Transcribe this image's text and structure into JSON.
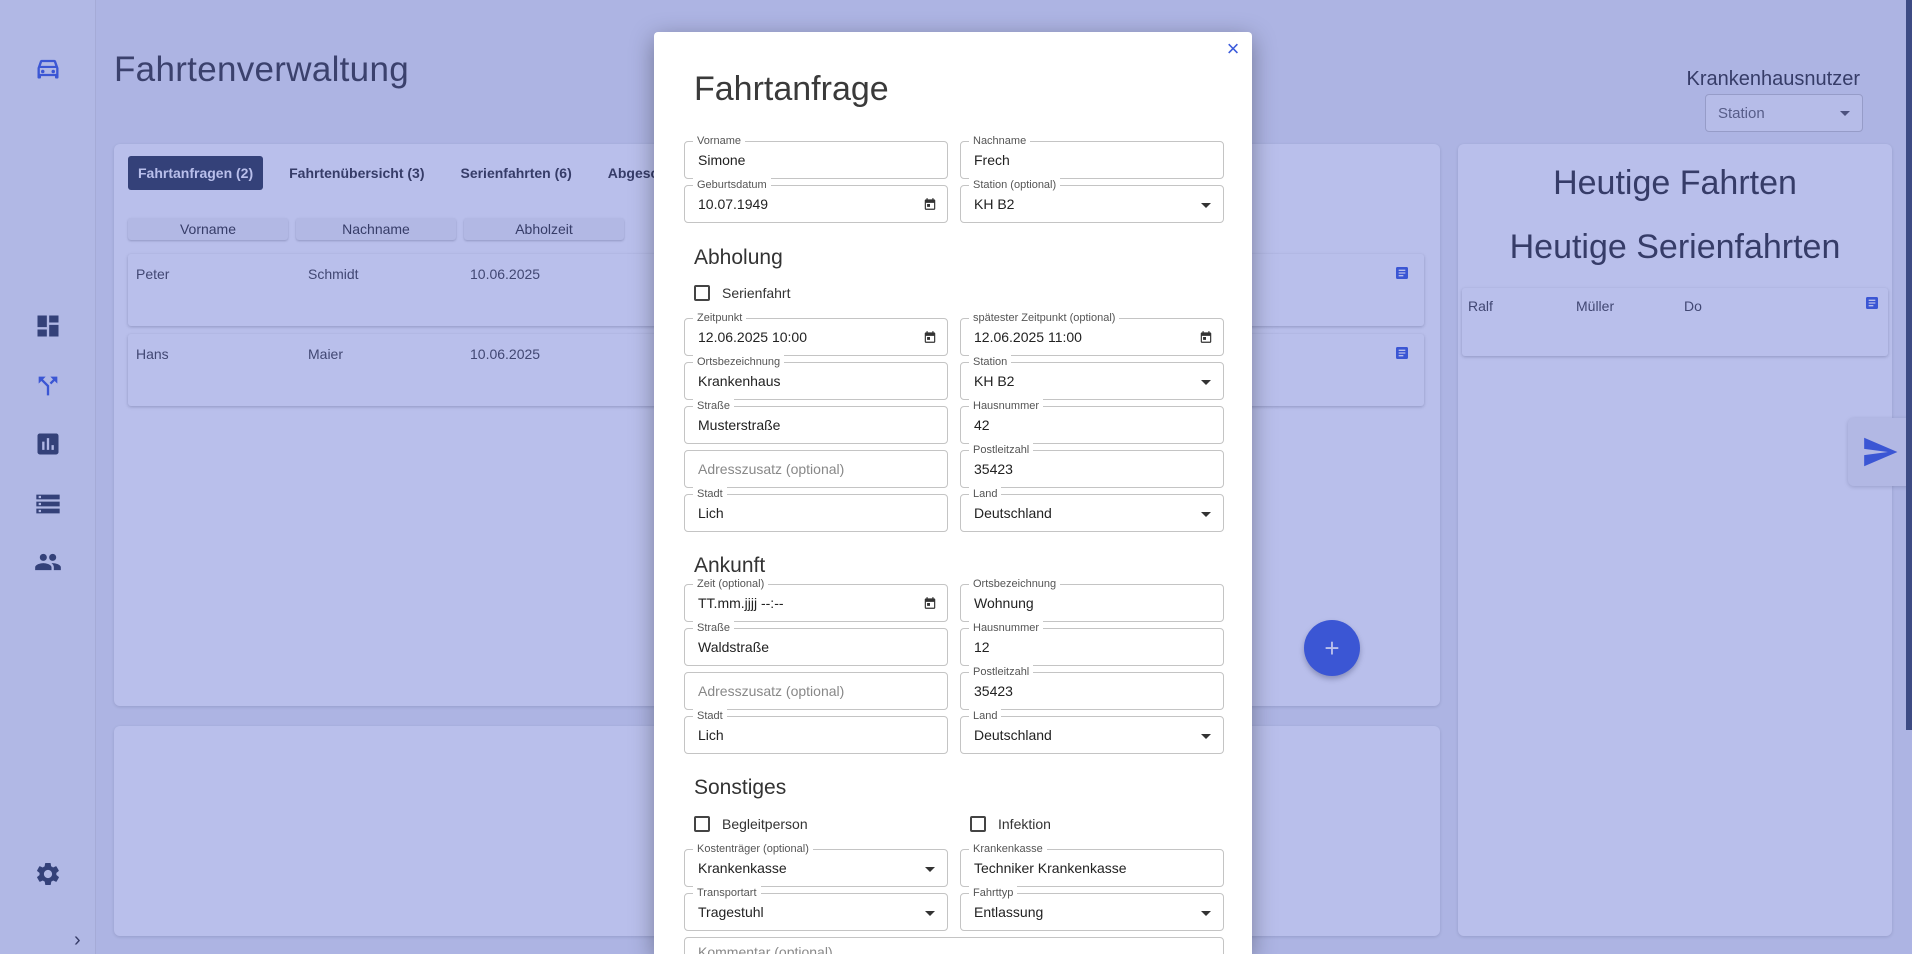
{
  "app": {
    "page_title": "Fahrtenverwaltung",
    "user_label": "Krankenhausnutzer",
    "station_select": "Station"
  },
  "tabs": [
    {
      "label": "Fahrtanfragen (2)",
      "active": true
    },
    {
      "label": "Fahrtenübersicht (3)",
      "active": false
    },
    {
      "label": "Serienfahrten (6)",
      "active": false
    },
    {
      "label": "Abgesc",
      "active": false
    }
  ],
  "table": {
    "headers": [
      "Vorname",
      "Nachname",
      "Abholzeit"
    ],
    "rows": [
      {
        "vorname": "Peter",
        "nachname": "Schmidt",
        "abholzeit": "10.06.2025"
      },
      {
        "vorname": "Hans",
        "nachname": "Maier",
        "abholzeit": "10.06.2025"
      }
    ]
  },
  "fab_label": "+",
  "right_panel": {
    "title1": "Heutige Fahrten",
    "title2": "Heutige Serienfahrten",
    "row": {
      "c1": "Ralf",
      "c2": "Müller",
      "c3": "Do"
    }
  },
  "modal": {
    "title": "Fahrtanfrage",
    "close": "×",
    "patient": {
      "vorname": {
        "label": "Vorname",
        "value": "Simone"
      },
      "nachname": {
        "label": "Nachname",
        "value": "Frech"
      },
      "geburtsdatum": {
        "label": "Geburtsdatum",
        "value": "10.07.1949"
      },
      "station": {
        "label": "Station (optional)",
        "value": "KH B2"
      }
    },
    "abholung": {
      "title": "Abholung",
      "serienfahrt": "Serienfahrt",
      "zeitpunkt": {
        "label": "Zeitpunkt",
        "value": "12.06.2025 10:00"
      },
      "spaetester": {
        "label": "spätester Zeitpunkt (optional)",
        "value": "12.06.2025 11:00"
      },
      "ortsbezeichnung": {
        "label": "Ortsbezeichnung",
        "value": "Krankenhaus"
      },
      "station": {
        "label": "Station",
        "value": "KH B2"
      },
      "strasse": {
        "label": "Straße",
        "value": "Musterstraße"
      },
      "hausnummer": {
        "label": "Hausnummer",
        "value": "42"
      },
      "adresszusatz": {
        "placeholder": "Adresszusatz (optional)"
      },
      "postleitzahl": {
        "label": "Postleitzahl",
        "value": "35423"
      },
      "stadt": {
        "label": "Stadt",
        "value": "Lich"
      },
      "land": {
        "label": "Land",
        "value": "Deutschland"
      }
    },
    "ankunft": {
      "title": "Ankunft",
      "zeit": {
        "label": "Zeit (optional)",
        "value": "TT.mm.jjjj --:--"
      },
      "ortsbezeichnung": {
        "label": "Ortsbezeichnung",
        "value": "Wohnung"
      },
      "strasse": {
        "label": "Straße",
        "value": "Waldstraße"
      },
      "hausnummer": {
        "label": "Hausnummer",
        "value": "12"
      },
      "adresszusatz": {
        "placeholder": "Adresszusatz (optional)"
      },
      "postleitzahl": {
        "label": "Postleitzahl",
        "value": "35423"
      },
      "stadt": {
        "label": "Stadt",
        "value": "Lich"
      },
      "land": {
        "label": "Land",
        "value": "Deutschland"
      }
    },
    "sonstiges": {
      "title": "Sonstiges",
      "begleitperson": "Begleitperson",
      "infektion": "Infektion",
      "kostentraeger": {
        "label": "Kostenträger (optional)",
        "value": "Krankenkasse"
      },
      "krankenkasse": {
        "label": "Krankenkasse",
        "value": "Techniker Krankenkasse"
      },
      "transportart": {
        "label": "Transportart",
        "value": "Tragestuhl"
      },
      "fahrttyp": {
        "label": "Fahrttyp",
        "value": "Entlassung"
      },
      "kommentar": {
        "placeholder": "Kommentar (optional)"
      }
    }
  },
  "colors": {
    "accent": "#3b5bdb",
    "overlay": "#3c4ec8",
    "tab_active": "#2f3b4d"
  },
  "icons": [
    "car-icon",
    "dashboard-icon",
    "route-icon",
    "chart-icon",
    "list-icon",
    "users-icon",
    "gear-icon",
    "calendar-icon",
    "document-icon",
    "send-icon",
    "close-icon",
    "chevron-down-icon"
  ]
}
